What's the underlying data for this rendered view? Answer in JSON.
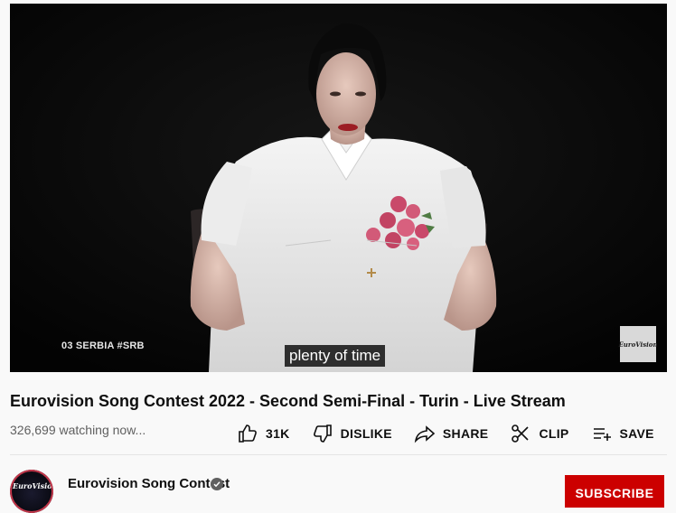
{
  "player": {
    "overlay_label": "03 SERBIA #SRB",
    "caption": "plenty of time",
    "watermark": "EuroVision"
  },
  "video": {
    "title": "Eurovision Song Contest 2022 - Second Semi-Final - Turin - Live Stream",
    "views": "326,699 watching now..."
  },
  "actions": {
    "like_label": "31K",
    "dislike_label": "DISLIKE",
    "share_label": "SHARE",
    "clip_label": "CLIP",
    "save_label": "SAVE"
  },
  "owner": {
    "channel_name": "Eurovision Song Contest",
    "avatar_text": "EuroVision",
    "subscribe_label": "SUBSCRIBE"
  },
  "colors": {
    "subscribe": "#cc0000",
    "accent_red": "#c2364a"
  }
}
